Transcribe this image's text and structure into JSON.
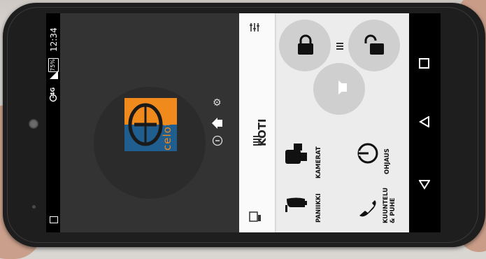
{
  "status": {
    "time": "12:34",
    "battery": "75%",
    "network": "4G"
  },
  "app": {
    "logo_text": "celotron",
    "title": "KOTI"
  },
  "tiles": [
    {
      "label": "KAMERAT",
      "icon": "camera-icon"
    },
    {
      "label": "OHJAUS",
      "icon": "power-icon"
    },
    {
      "label": "PANIIKKI",
      "icon": "bell-icon"
    },
    {
      "label_line1": "KUUNTELU",
      "label_line2": "& PUHE",
      "icon": "phone-icon"
    }
  ],
  "colors": {
    "logo_orange": "#f08a1c",
    "logo_blue": "#1f5e8f",
    "drawer_bg": "#333333",
    "panel_bg": "#ececec"
  }
}
